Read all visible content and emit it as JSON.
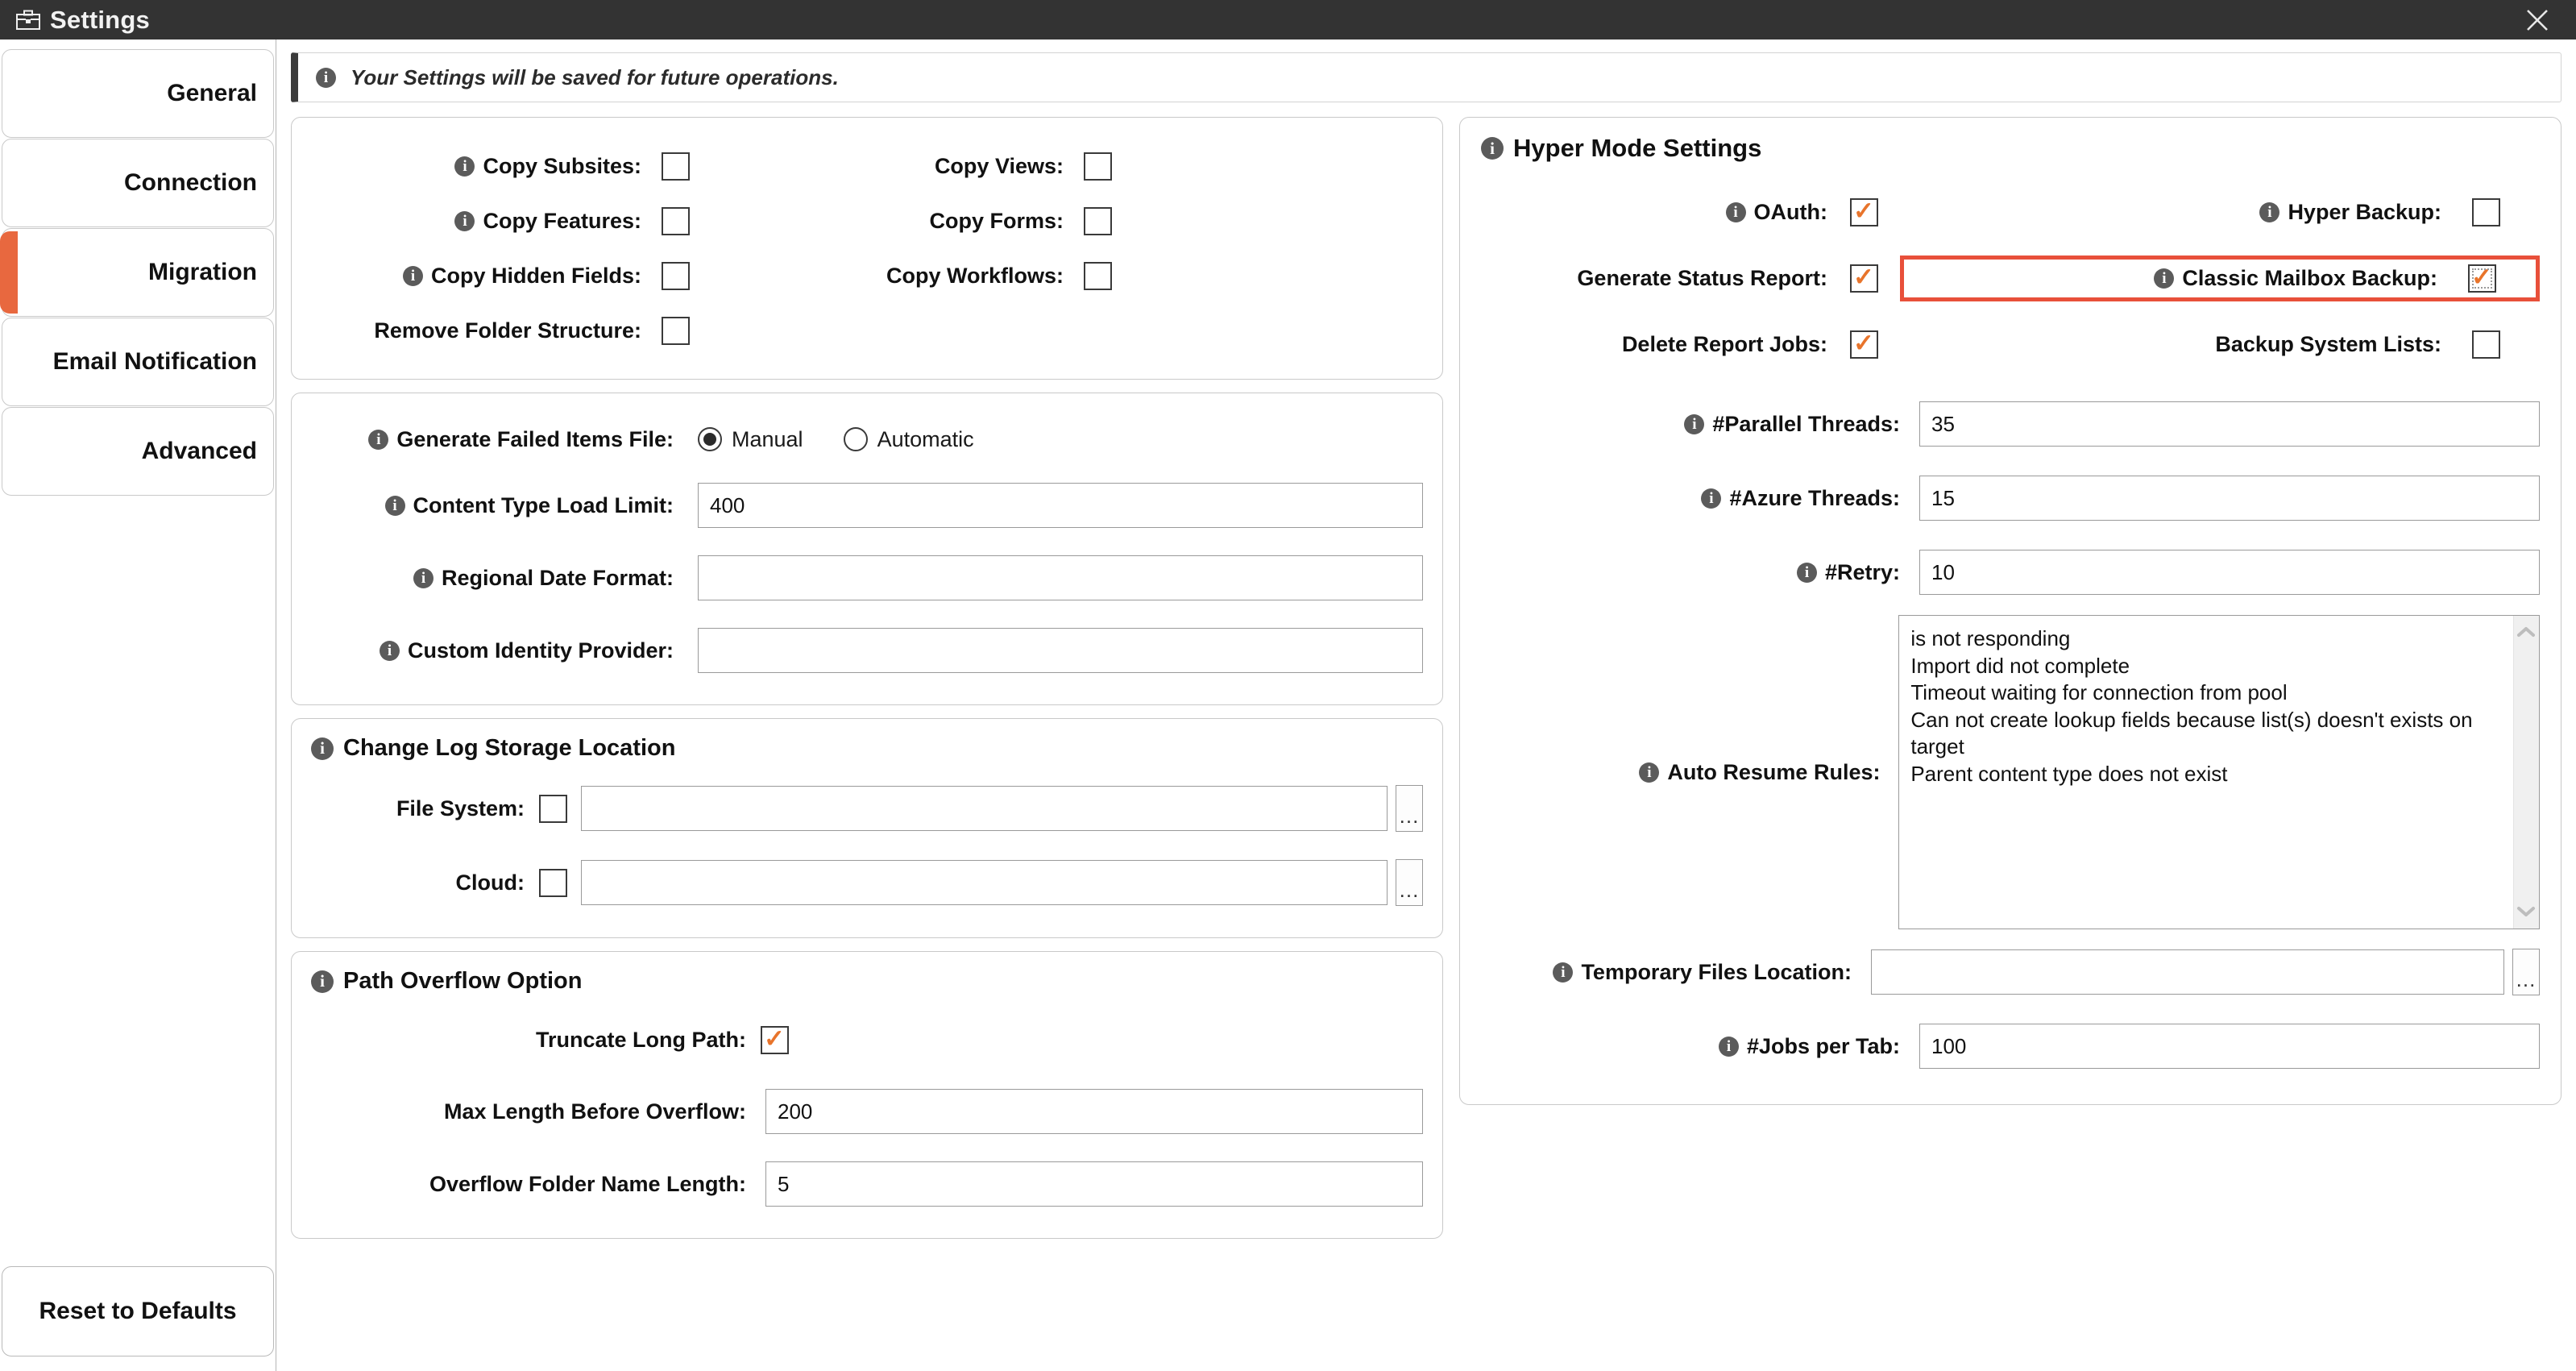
{
  "window": {
    "title": "Settings",
    "icon": "briefcase-icon",
    "close_label": "✕"
  },
  "sidebar": {
    "tabs": [
      {
        "label": "General",
        "active": false
      },
      {
        "label": "Connection",
        "active": false
      },
      {
        "label": "Migration",
        "active": true
      },
      {
        "label": "Email Notification",
        "active": false
      },
      {
        "label": "Advanced",
        "active": false
      }
    ],
    "reset_label": "Reset to Defaults"
  },
  "banner": {
    "icon": "info-icon",
    "text": "Your Settings will be saved for future operations."
  },
  "left_panel": {
    "copy_options": {
      "rows": [
        {
          "label": "Copy Subsites:",
          "info": true,
          "checked": false,
          "label2": "Copy Views:",
          "info2": false,
          "checked2": false
        },
        {
          "label": "Copy Features:",
          "info": true,
          "checked": false,
          "label2": "Copy Forms:",
          "info2": false,
          "checked2": false
        },
        {
          "label": "Copy Hidden Fields:",
          "info": true,
          "checked": false,
          "label2": "Copy Workflows:",
          "info2": false,
          "checked2": false
        },
        {
          "label": "Remove Folder Structure:",
          "info": false,
          "checked": false,
          "label2": "",
          "info2": false,
          "checked2": null
        }
      ]
    },
    "general_group": {
      "failed_items_label": "Generate Failed Items File:",
      "radio_manual": "Manual",
      "radio_automatic": "Automatic",
      "radio_selected": "Manual",
      "content_type_label": "Content Type Load Limit:",
      "content_type_value": "400",
      "regional_date_label": "Regional Date Format:",
      "regional_date_value": "",
      "identity_provider_label": "Custom Identity Provider:",
      "identity_provider_value": ""
    },
    "change_log": {
      "title": "Change Log Storage Location",
      "file_system_label": "File System:",
      "file_system_checked": false,
      "file_system_value": "",
      "cloud_label": "Cloud:",
      "cloud_checked": false,
      "cloud_value": "",
      "browse_label": "..."
    },
    "path_overflow": {
      "title": "Path Overflow Option",
      "truncate_label": "Truncate Long Path:",
      "truncate_checked": true,
      "max_length_label": "Max Length Before Overflow:",
      "max_length_value": "200",
      "folder_name_label": "Overflow Folder Name Length:",
      "folder_name_value": "5"
    }
  },
  "right_panel": {
    "title": "Hyper Mode Settings",
    "checkbox_rows": [
      {
        "label": "OAuth:",
        "info": true,
        "checked": true,
        "label2": "Hyper Backup:",
        "info2": true,
        "checked2": false,
        "highlight2": false
      },
      {
        "label": "Generate Status Report:",
        "info": false,
        "checked": true,
        "label2": "Classic Mailbox Backup:",
        "info2": true,
        "checked2": true,
        "highlight2": true
      },
      {
        "label": "Delete Report Jobs:",
        "info": false,
        "checked": true,
        "label2": "Backup System Lists:",
        "info2": false,
        "checked2": false,
        "highlight2": false
      }
    ],
    "fields": [
      {
        "label": "#Parallel Threads:",
        "value": "35"
      },
      {
        "label": "#Azure Threads:",
        "value": "15"
      },
      {
        "label": "#Retry:",
        "value": "10"
      }
    ],
    "auto_resume": {
      "label": "Auto Resume Rules:",
      "rules": [
        "is not responding",
        "Import did not complete",
        "Timeout waiting for connection from pool",
        "Can not create lookup fields because list(s) doesn't exists on target",
        "Parent content type does not exist"
      ],
      "scroll_up": "▲",
      "scroll_down": "▼"
    },
    "temp_files": {
      "label": "Temporary Files Location:",
      "value": "",
      "browse_label": "..."
    },
    "jobs_per_tab": {
      "label": "#Jobs per Tab:",
      "value": "100"
    }
  },
  "colors": {
    "accent_orange": "#E8683F",
    "check_orange": "#E8742B",
    "highlight_red": "#E8503A",
    "titlebar": "#333333"
  }
}
